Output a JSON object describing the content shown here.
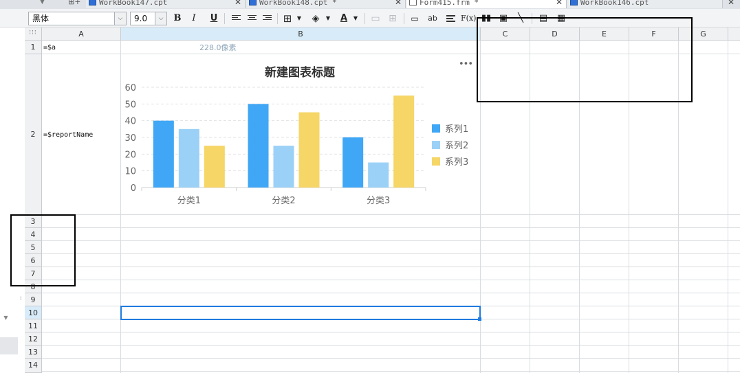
{
  "tabs": [
    {
      "label": "WorkBook147.cpt",
      "icon": "report-icon",
      "active": false
    },
    {
      "label": "WorkBook148.cpt *",
      "icon": "report-icon",
      "active": false
    },
    {
      "label": "Form415.frm *",
      "icon": "form-icon",
      "active": true
    },
    {
      "label": "WorkBook146.cpt",
      "icon": "report-icon",
      "active": false
    }
  ],
  "toolbar": {
    "font_family": "黑体",
    "font_size": "9.0",
    "bold": "B",
    "italic": "I",
    "underline": "U",
    "font_color_label": "A",
    "text_tool": "ab",
    "formula_tool": "F(x)"
  },
  "grid": {
    "corner": "⁝⁝⁝",
    "columns": [
      "A",
      "B",
      "C",
      "D",
      "E",
      "F",
      "G"
    ],
    "selected_column": "B",
    "rows": [
      "1",
      "2",
      "3",
      "4",
      "5",
      "6",
      "7",
      "8",
      "9",
      "10",
      "11",
      "12",
      "13",
      "14"
    ],
    "selected_row": "10",
    "cells": {
      "A1": "=$a",
      "A2": "=$reportName"
    },
    "width_hint": "228.0像素"
  },
  "chart_data": {
    "type": "bar",
    "title": "新建图表标题",
    "categories": [
      "分类1",
      "分类2",
      "分类3"
    ],
    "series": [
      {
        "name": "系列1",
        "values": [
          40,
          50,
          30
        ],
        "color": "#3fa7f5"
      },
      {
        "name": "系列2",
        "values": [
          35,
          25,
          15
        ],
        "color": "#9bd1f7"
      },
      {
        "name": "系列3",
        "values": [
          25,
          45,
          55
        ],
        "color": "#f5d666"
      }
    ],
    "ylim": [
      0,
      60
    ],
    "yticks": [
      "0",
      "10",
      "20",
      "30",
      "40",
      "50",
      "60"
    ],
    "grid": true,
    "legend": "right",
    "more_label": "•••"
  },
  "colors": {
    "selection": "#1f7be0",
    "header_selected": "#d8ebf9"
  }
}
